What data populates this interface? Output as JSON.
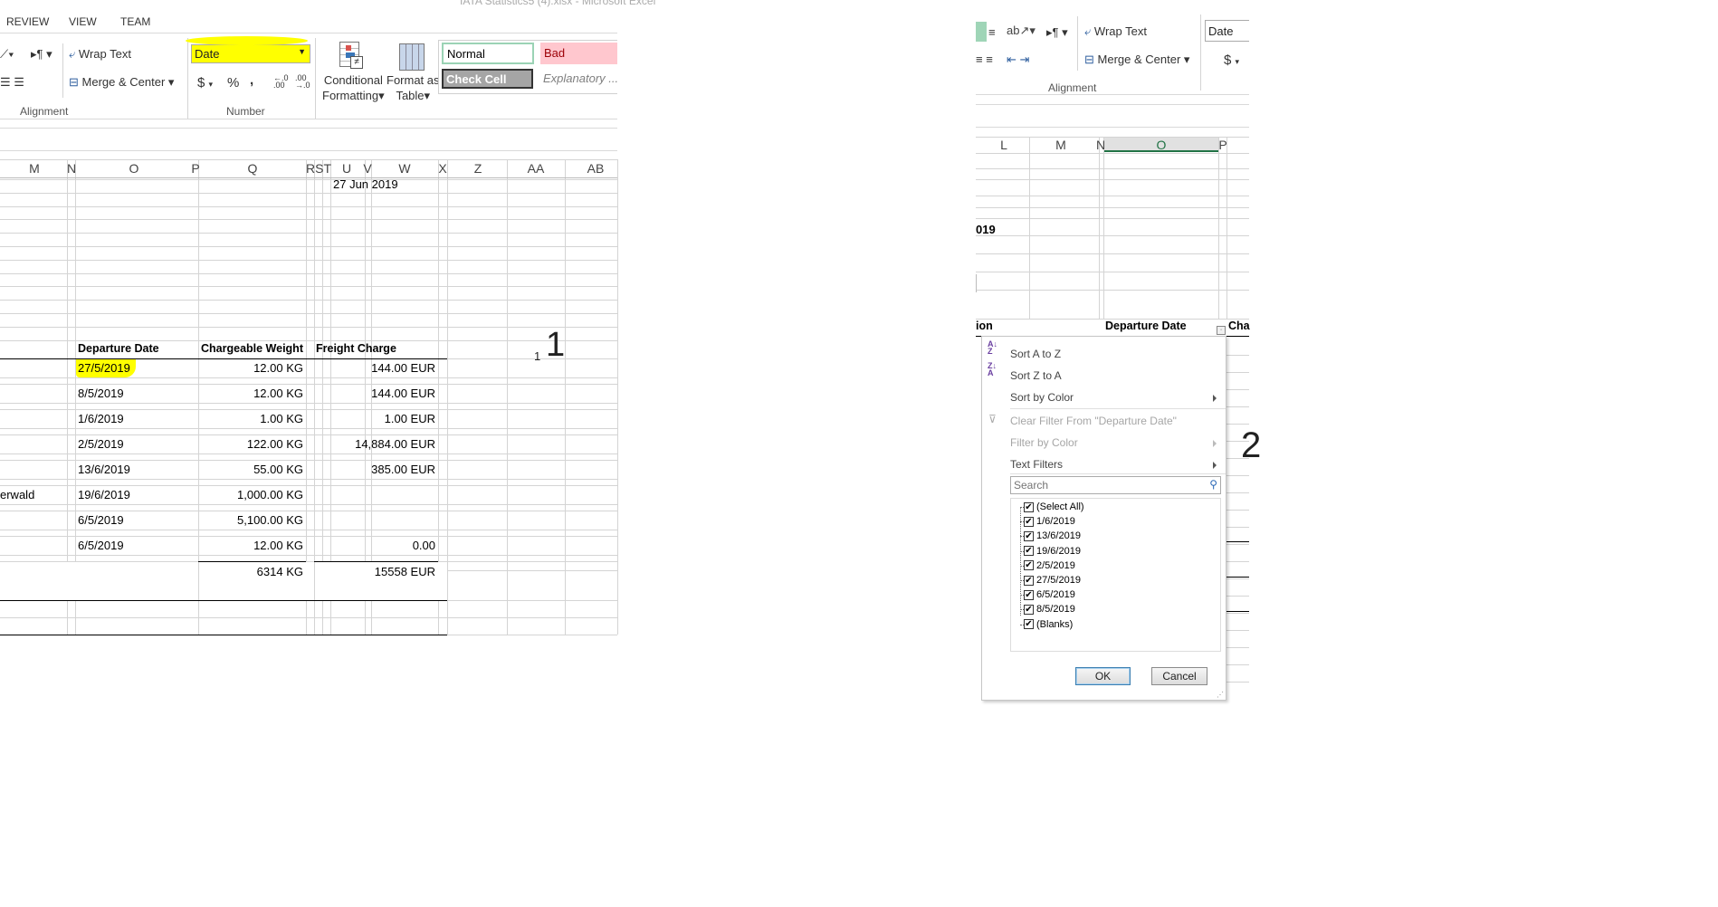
{
  "window_title": "IATA Statistics5 (4).xlsx - Microsoft Excel",
  "left": {
    "tabs": [
      "REVIEW",
      "VIEW",
      "TEAM"
    ],
    "ribbon": {
      "wrap_text": "Wrap Text",
      "merge_center": "Merge & Center",
      "number_format": "Date",
      "currency": "$",
      "percent": "%",
      "comma": ",",
      "conditional_formatting": [
        "Conditional",
        "Formatting"
      ],
      "format_as_table": [
        "Format as",
        "Table"
      ],
      "styles": {
        "normal": "Normal",
        "bad": "Bad",
        "check_cell": "Check Cell",
        "explanatory": "Explanatory ..."
      },
      "groups": {
        "alignment": "Alignment",
        "number": "Number"
      }
    },
    "columns": [
      "M",
      "N",
      "O",
      "P",
      "Q",
      "RST",
      "U",
      "V",
      "W",
      "X",
      "Z",
      "AA",
      "AB"
    ],
    "date_cell": "27 Jun 2019",
    "headers": {
      "departure": "Departure Date",
      "weight": "Chargeable Weight",
      "charge": "Freight Charge"
    },
    "rows": [
      {
        "name": "",
        "date": "27/5/2019",
        "weight": "12.00 KG",
        "charge": "144.00 EUR",
        "highlight": true
      },
      {
        "name": "",
        "date": "8/5/2019",
        "weight": "12.00 KG",
        "charge": "144.00 EUR"
      },
      {
        "name": "",
        "date": "1/6/2019",
        "weight": "1.00 KG",
        "charge": "1.00 EUR"
      },
      {
        "name": "",
        "date": "2/5/2019",
        "weight": "122.00 KG",
        "charge": "14,884.00 EUR"
      },
      {
        "name": "",
        "date": "13/6/2019",
        "weight": "55.00 KG",
        "charge": "385.00 EUR"
      },
      {
        "name": "erwald",
        "date": "19/6/2019",
        "weight": "1,000.00 KG",
        "charge": ""
      },
      {
        "name": "",
        "date": "6/5/2019",
        "weight": "5,100.00 KG",
        "charge": ""
      },
      {
        "name": "",
        "date": "6/5/2019",
        "weight": "12.00 KG",
        "charge": "0.00"
      }
    ],
    "totals": {
      "weight": "6314 KG",
      "charge": "15558 EUR"
    },
    "annotation_small": "1",
    "annotation": "1"
  },
  "right": {
    "ribbon": {
      "wrap_text": "Wrap Text",
      "merge_center": "Merge & Center",
      "number_format": "Date",
      "currency": "$",
      "group": "Alignment"
    },
    "columns": [
      "L",
      "M",
      "N",
      "O",
      "P"
    ],
    "selected_column": "O",
    "year_fragment": "019",
    "header_fragment": "ion",
    "departure_header": "Departure Date",
    "next_header_fragment": "Cha",
    "filter_menu": {
      "sort_az": "Sort A to Z",
      "sort_za": "Sort Z to A",
      "sort_color": "Sort by Color",
      "clear_filter": "Clear Filter From \"Departure Date\"",
      "filter_color": "Filter by Color",
      "text_filters": "Text Filters",
      "search_placeholder": "Search",
      "items": [
        {
          "label": "(Select All)",
          "checked": true
        },
        {
          "label": "1/6/2019",
          "checked": true
        },
        {
          "label": "13/6/2019",
          "checked": true
        },
        {
          "label": "19/6/2019",
          "checked": true
        },
        {
          "label": "2/5/2019",
          "checked": true
        },
        {
          "label": "27/5/2019",
          "checked": true
        },
        {
          "label": "6/5/2019",
          "checked": true
        },
        {
          "label": "8/5/2019",
          "checked": true
        },
        {
          "label": "(Blanks)",
          "checked": true
        }
      ],
      "ok": "OK",
      "cancel": "Cancel"
    },
    "annotation": "2"
  },
  "colors": {
    "highlight": "#ffff00",
    "bad_bg": "#ffc7ce",
    "bad_text": "#9c0006",
    "check_cell_bg": "#a5a5a5",
    "normal_border": "#9bd3b5",
    "selected_col_bg": "#e1e1e1",
    "selected_col_line": "#217346"
  }
}
